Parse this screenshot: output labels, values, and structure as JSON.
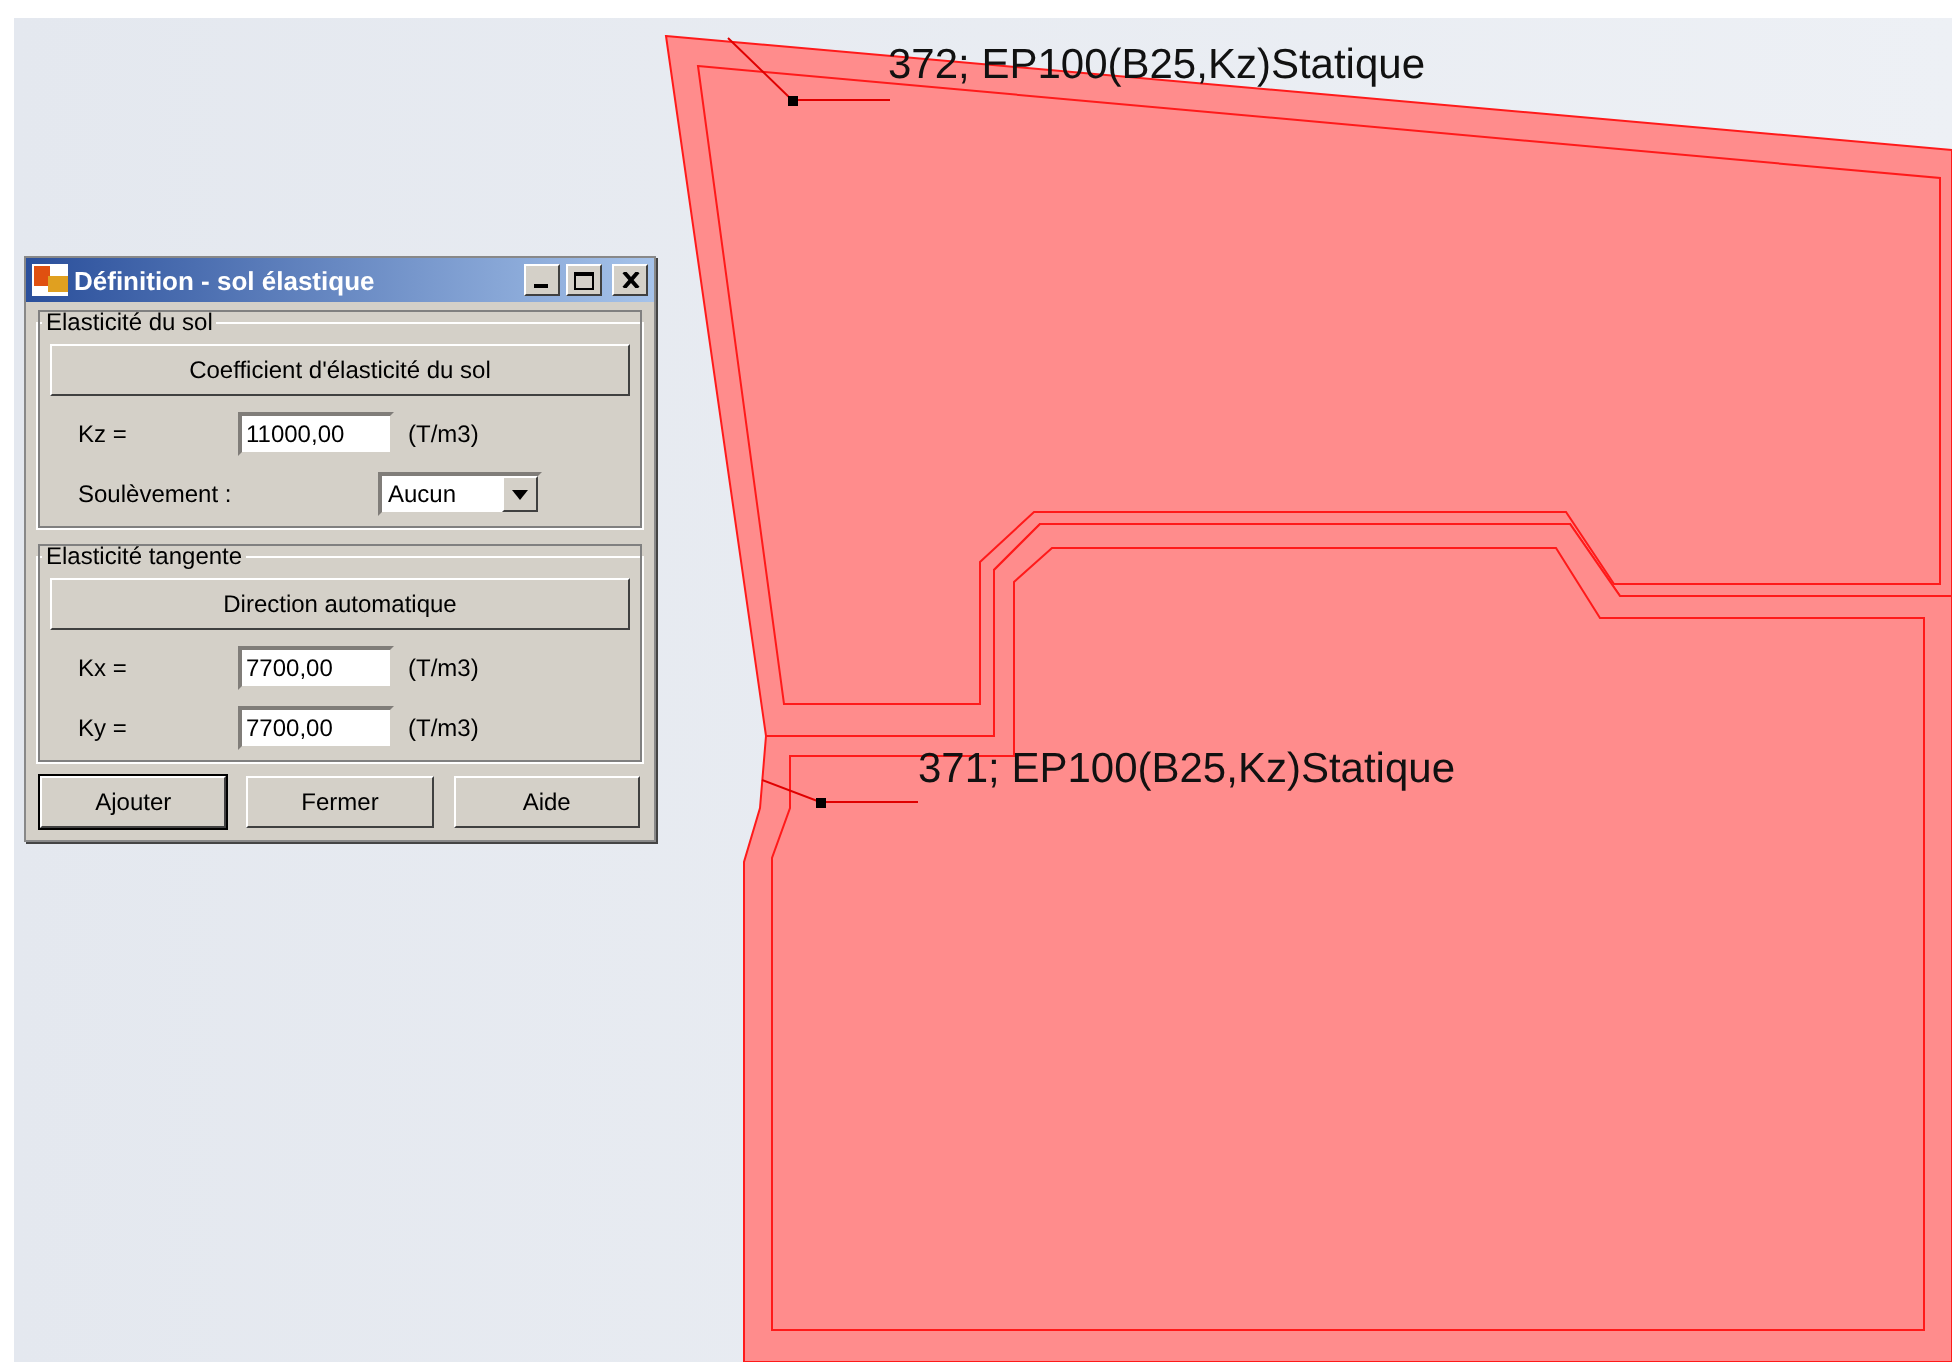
{
  "canvas": {
    "panels": [
      {
        "label": "372; EP100(B25,Kz)Statique",
        "kind": "upper"
      },
      {
        "label": "371; EP100(B25,Kz)Statique",
        "kind": "lower"
      }
    ]
  },
  "dialog": {
    "title": "Définition - sol élastique",
    "groups": [
      {
        "title": "Elasticité du sol",
        "button": "Coefficient d'élasticité du sol",
        "fields": [
          {
            "kind": "input",
            "label": "Kz =",
            "value": "11000,00",
            "unit": "(T/m3)"
          },
          {
            "kind": "select",
            "label": "Soulèvement :",
            "value": "Aucun"
          }
        ]
      },
      {
        "title": "Elasticité tangente",
        "button": "Direction automatique",
        "fields": [
          {
            "kind": "input",
            "label": "Kx =",
            "value": "7700,00",
            "unit": "(T/m3)"
          },
          {
            "kind": "input",
            "label": "Ky =",
            "value": "7700,00",
            "unit": "(T/m3)"
          }
        ]
      }
    ],
    "buttons": [
      {
        "label": "Ajouter",
        "selected": true
      },
      {
        "label": "Fermer",
        "selected": false
      },
      {
        "label": "Aide",
        "selected": false
      }
    ]
  }
}
